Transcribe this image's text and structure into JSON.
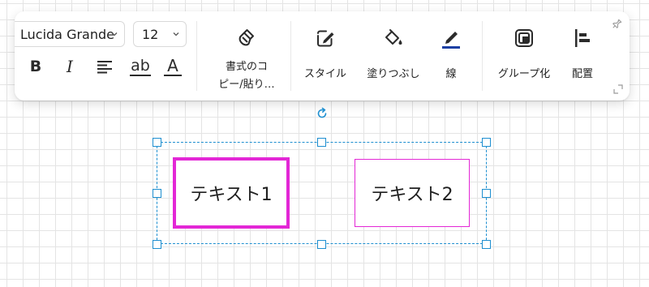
{
  "toolbar": {
    "font_family": {
      "value": "Lucida Grande"
    },
    "font_size": {
      "value": "12"
    },
    "format_buttons": [
      "bold",
      "italic",
      "align",
      "underline",
      "text-color"
    ],
    "tools": {
      "copy_format": {
        "label": "書式のコピー/貼り…",
        "line1": "書式のコ",
        "line2": "ピー/貼り…"
      },
      "style": {
        "label": "スタイル"
      },
      "fill": {
        "label": "塗りつぶし"
      },
      "line": {
        "label": "線"
      },
      "group": {
        "label": "グループ化"
      },
      "arrange": {
        "label": "配置"
      }
    },
    "format_glyphs": {
      "bold": "B",
      "italic": "I",
      "underline": "ab",
      "text_color": "A"
    }
  },
  "diagram": {
    "shapes": [
      {
        "text": "テキスト1",
        "border": "thick"
      },
      {
        "text": "テキスト2",
        "border": "thin"
      }
    ]
  },
  "colors": {
    "shape_border": "#e327d6",
    "selection": "#1e8fd0",
    "icon": "#2b2b2b",
    "line_underline": "#1a3fa3"
  }
}
